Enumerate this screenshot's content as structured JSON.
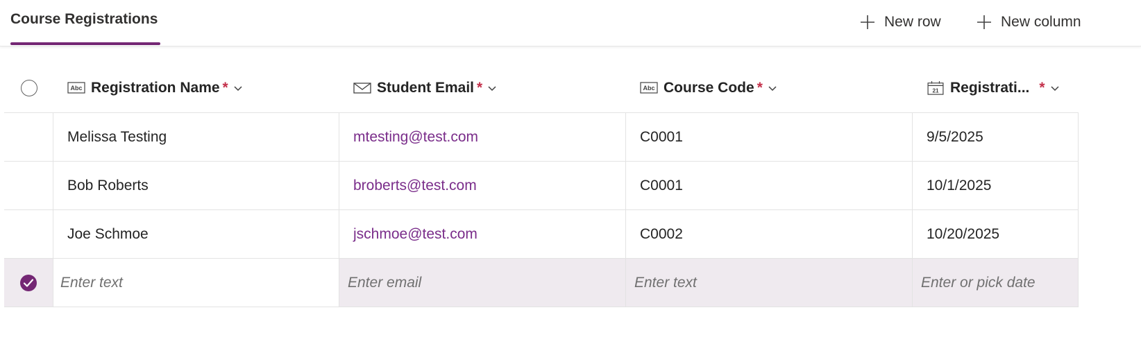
{
  "header": {
    "tab_label": "Course Registrations",
    "new_row_label": "New row",
    "new_column_label": "New column",
    "accent_color": "#742774"
  },
  "columns": [
    {
      "label": "Registration Name",
      "required_marker": "*",
      "icon": "text-abc-icon"
    },
    {
      "label": "Student Email",
      "required_marker": "*",
      "icon": "mail-icon"
    },
    {
      "label": "Course Code",
      "required_marker": "*",
      "icon": "text-abc-icon"
    },
    {
      "label": "Registrati...",
      "required_marker": "*",
      "icon": "calendar-icon"
    }
  ],
  "rows": [
    {
      "name": "Melissa Testing",
      "email": "mtesting@test.com",
      "course": "C0001",
      "date": "9/5/2025"
    },
    {
      "name": "Bob Roberts",
      "email": "broberts@test.com",
      "course": "C0001",
      "date": "10/1/2025"
    },
    {
      "name": "Joe Schmoe",
      "email": "jschmoe@test.com",
      "course": "C0002",
      "date": "10/20/2025"
    }
  ],
  "new_row": {
    "name_placeholder": "Enter text",
    "email_placeholder": "Enter email",
    "course_placeholder": "Enter text",
    "date_placeholder": "Enter or pick date"
  },
  "colors": {
    "email_link": "#7a2d8a",
    "required": "#c4314b",
    "new_row_bg": "#efeaef"
  }
}
